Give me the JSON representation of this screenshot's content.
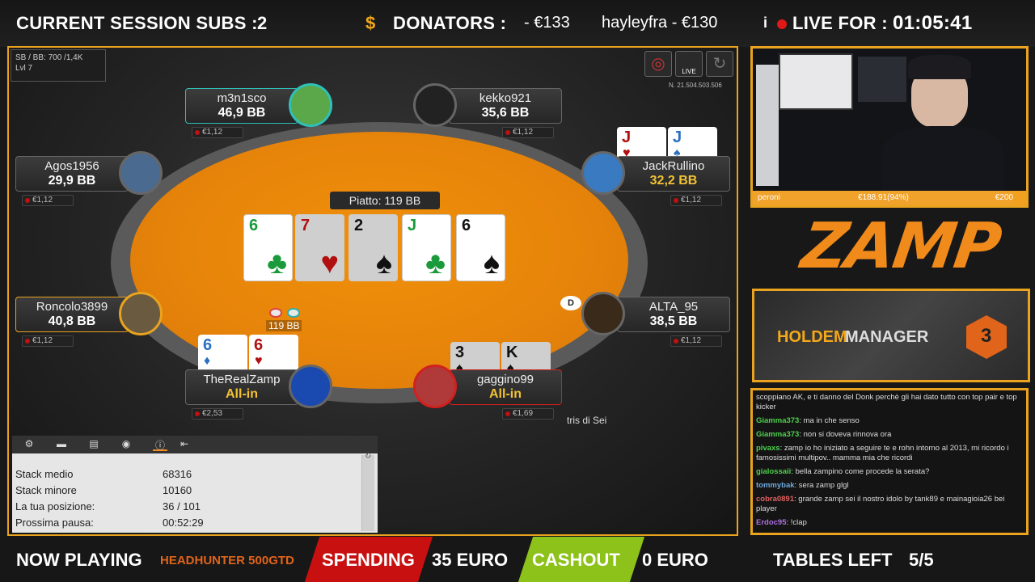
{
  "overlay": {
    "subs_label": "CURRENT SESSION SUBS :",
    "subs_value": "2",
    "dollar": "$",
    "donators_label": "DONATORS :",
    "donators_value": "- €133",
    "donator2": "hayleyfra - €130",
    "info_i": "i",
    "live_label": "LIVE FOR :",
    "live_time": "01:05:41",
    "now_playing": "NOW PLAYING",
    "tournament": "HEADHUNTER 500GTD",
    "spending_label": "SPENDING",
    "spending_value": "35 EURO",
    "cashout_label": "CASHOUT",
    "cashout_value": "0 EURO",
    "tables_label": "TABLES LEFT",
    "tables_value": "5/5",
    "logo": "ZAMP",
    "hm_brand1": "HOLDEM",
    "hm_brand2": "MANAGER",
    "hm_num": "3"
  },
  "table": {
    "blinds": "SB / BB: 700 /1,4K",
    "level": "Lvl 7",
    "hand_no": "N. 21.504.503.506",
    "live_badge": "LIVE",
    "pot": "Piatto: 119 BB",
    "bet_chips": "119 BB",
    "dealer": "D",
    "tris": "tris di Sei",
    "board": [
      {
        "rank": "6",
        "suit": "♣",
        "color": "#1a9a3a",
        "dim": false
      },
      {
        "rank": "7",
        "suit": "♥",
        "color": "#b01010",
        "dim": true
      },
      {
        "rank": "2",
        "suit": "♠",
        "color": "#111111",
        "dim": true
      },
      {
        "rank": "J",
        "suit": "♣",
        "color": "#1a9a3a",
        "dim": false
      },
      {
        "rank": "6",
        "suit": "♠",
        "color": "#111111",
        "dim": false
      }
    ],
    "seats": [
      {
        "name": "m3n1sco",
        "stack": "46,9 BB",
        "fee": "€1,12"
      },
      {
        "name": "kekko921",
        "stack": "35,6 BB",
        "fee": "€1,12"
      },
      {
        "name": "Agos1956",
        "stack": "29,9 BB",
        "fee": "€1,12"
      },
      {
        "name": "JackRullino",
        "stack": "32,2 BB",
        "fee": "€1,12"
      },
      {
        "name": "Roncolo3899",
        "stack": "40,8 BB",
        "fee": "€1,12"
      },
      {
        "name": "ALTA_95",
        "stack": "38,5 BB",
        "fee": "€1,12"
      },
      {
        "name": "TheRealZamp",
        "stack": "All-in",
        "fee": "€2,53"
      },
      {
        "name": "gaggino99",
        "stack": "All-in",
        "fee": "€1,69"
      }
    ],
    "hole_cards": {
      "jack": [
        {
          "rank": "J",
          "suit": "♥",
          "color": "#b01010"
        },
        {
          "rank": "J",
          "suit": "♠",
          "color": "#2a70c0"
        }
      ],
      "zamp": [
        {
          "rank": "6",
          "suit": "♦",
          "color": "#2a70c0"
        },
        {
          "rank": "6",
          "suit": "♥",
          "color": "#b01010"
        }
      ],
      "gaggino": [
        {
          "rank": "3",
          "suit": "♠",
          "color": "#111111"
        },
        {
          "rank": "K",
          "suit": "♠",
          "color": "#111111"
        }
      ]
    }
  },
  "stats_panel": {
    "rows": [
      {
        "label": "Stack medio",
        "value": "68316"
      },
      {
        "label": "Stack minore",
        "value": "10160"
      },
      {
        "label": "La tua posizione:",
        "value": "36 / 101"
      },
      {
        "label": "Prossima pausa:",
        "value": "00:52:29"
      }
    ]
  },
  "webcam_bar": {
    "user": "peroni",
    "amount": "€188.91(94%)",
    "goal": "€200"
  },
  "chat": [
    {
      "user": "",
      "text": "scoppiano AK, e ti danno del Donk perchè gli hai dato tutto con top pair e top kicker",
      "color": "#dddddd"
    },
    {
      "user": "Giamma373",
      "text": "ma in che senso",
      "color": "#4fd04f"
    },
    {
      "user": "Giamma373",
      "text": "non si doveva rinnova ora",
      "color": "#4fd04f"
    },
    {
      "user": "pivaxs",
      "text": "zamp io ho iniziato a seguire te e rohn intorno al 2013, mi ricordo i famosissimi multipov.. mamma mia che ricordi",
      "color": "#4fd04f"
    },
    {
      "user": "gialossaii",
      "text": "bella zampino come procede la serata?",
      "color": "#4fd04f"
    },
    {
      "user": "tommybak",
      "text": "sera zamp glgl",
      "color": "#6fa8dc"
    },
    {
      "user": "cobra0891",
      "text": "grande zamp sei il nostro idolo by tank89 e mainagioia26 bei player",
      "color": "#e06060"
    },
    {
      "user": "Erdoc95",
      "text": "!clap",
      "color": "#b070e0"
    }
  ]
}
